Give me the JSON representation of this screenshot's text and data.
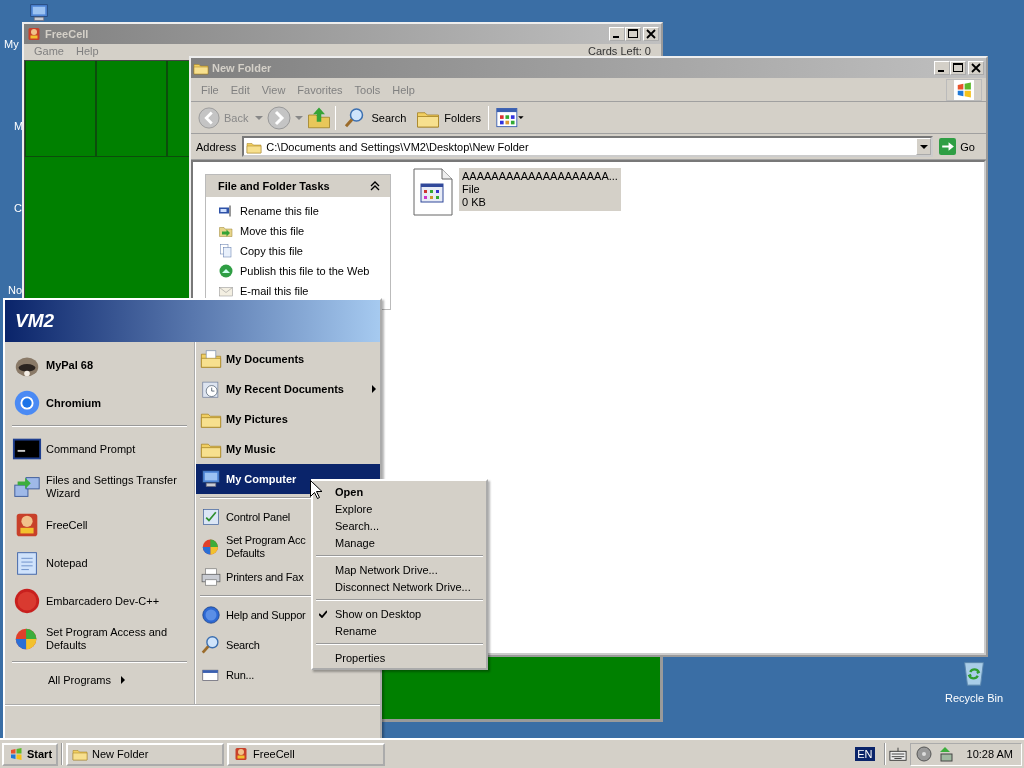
{
  "desktop": {
    "icons": [
      {
        "label": "My"
      },
      {
        "label": "M"
      },
      {
        "label": "C"
      },
      {
        "label": "No"
      },
      {
        "label": "Recycle Bin"
      }
    ]
  },
  "freecell": {
    "title": "FreeCell",
    "active": false,
    "menu": [
      "Game",
      "Help"
    ],
    "cards_left": "Cards Left: 0"
  },
  "explorer": {
    "title": "New Folder",
    "active": false,
    "menu": [
      "File",
      "Edit",
      "View",
      "Favorites",
      "Tools",
      "Help"
    ],
    "toolbar": {
      "back": {
        "label": "Back",
        "disabled": true
      },
      "search": "Search",
      "folders": "Folders"
    },
    "address": {
      "label": "Address",
      "value": "C:\\Documents and Settings\\VM2\\Desktop\\New Folder",
      "go": "Go"
    },
    "tasks": {
      "title": "File and Folder Tasks",
      "expanded": true,
      "items": [
        "Rename this file",
        "Move this file",
        "Copy this file",
        "Publish this file to the Web",
        "E-mail this file"
      ]
    },
    "files": [
      {
        "name": "AAAAAAAAAAAAAAAAAAAA...",
        "type": "File",
        "size": "0 KB",
        "selected": true
      }
    ]
  },
  "start_menu": {
    "user": "VM2",
    "pinned": [
      {
        "label": "MyPal 68",
        "selected": false
      },
      {
        "label": "Chromium",
        "selected": false
      }
    ],
    "recent": [
      {
        "label": "Command Prompt",
        "selected": false
      },
      {
        "label": "Files and Settings Transfer Wizard",
        "selected": false
      },
      {
        "label": "FreeCell",
        "selected": false
      },
      {
        "label": "Notepad",
        "selected": false
      },
      {
        "label": "Embarcadero Dev-C++",
        "selected": false
      },
      {
        "label": "Set Program Access and Defaults",
        "selected": false
      }
    ],
    "all_programs": "All Programs",
    "places": [
      {
        "label": "My Documents",
        "selected": false,
        "submenu": false
      },
      {
        "label": "My Recent Documents",
        "selected": false,
        "submenu": true
      },
      {
        "label": "My Pictures",
        "selected": false,
        "submenu": false
      },
      {
        "label": "My Music",
        "selected": false,
        "submenu": false
      },
      {
        "label": "My Computer",
        "selected": true,
        "submenu": false
      }
    ],
    "system": [
      {
        "label": "Control Panel",
        "selected": false
      },
      {
        "label": "Set Program Acc\nDefaults",
        "selected": false
      },
      {
        "label": "Printers and Fax",
        "selected": false
      },
      {
        "label": "Help and Suppor",
        "selected": false
      },
      {
        "label": "Search",
        "selected": false
      },
      {
        "label": "Run...",
        "selected": false
      }
    ]
  },
  "context_menu": {
    "items": [
      {
        "kind": "item",
        "label": "Open",
        "default": true,
        "checked": false
      },
      {
        "kind": "item",
        "label": "Explore",
        "default": false,
        "checked": false
      },
      {
        "kind": "item",
        "label": "Search...",
        "default": false,
        "checked": false
      },
      {
        "kind": "item",
        "label": "Manage",
        "default": false,
        "checked": false
      },
      {
        "kind": "separator"
      },
      {
        "kind": "item",
        "label": "Map Network Drive...",
        "default": false,
        "checked": false
      },
      {
        "kind": "item",
        "label": "Disconnect Network Drive...",
        "default": false,
        "checked": false
      },
      {
        "kind": "separator"
      },
      {
        "kind": "item",
        "label": "Show on Desktop",
        "default": false,
        "checked": true
      },
      {
        "kind": "item",
        "label": "Rename",
        "default": false,
        "checked": false
      },
      {
        "kind": "separator"
      },
      {
        "kind": "item",
        "label": "Properties",
        "default": false,
        "checked": false
      }
    ]
  },
  "taskbar": {
    "start": "Start",
    "tasks": [
      {
        "label": "New Folder",
        "selected": false
      },
      {
        "label": "FreeCell",
        "selected": false
      }
    ],
    "language": "EN",
    "clock": "10:28 AM"
  }
}
